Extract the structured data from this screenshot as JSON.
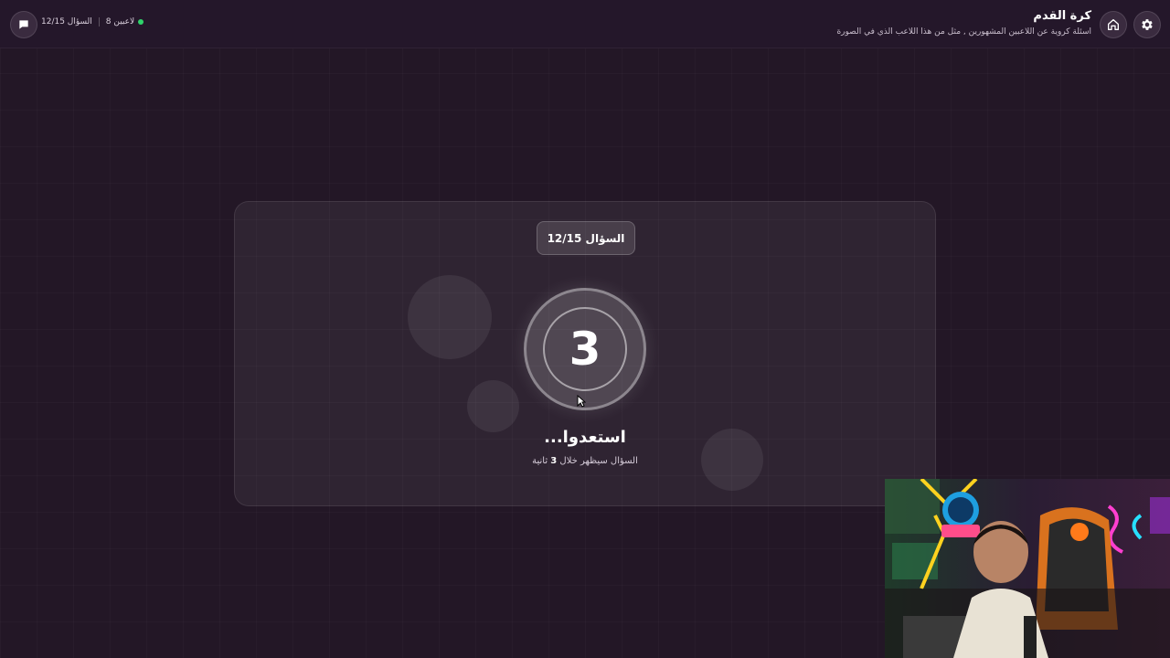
{
  "header": {
    "title": "كرة القدم",
    "subtitle": "اسئلة كروية عن اللاعبين المشهورين , مثل من هذا اللاعب الذي في الصورة",
    "status": {
      "players": "8 لاعبين",
      "question": "السؤال 12/15"
    },
    "icons": {
      "settings": "gear-icon",
      "home": "home-icon",
      "chat": "chat-icon"
    }
  },
  "card": {
    "question_badge": "السؤال 12/15",
    "countdown": "3",
    "ready_text": "استعدوا...",
    "sub_text_prefix": "السؤال سيظهر خلال ",
    "sub_text_number": "3",
    "sub_text_suffix": " ثانية"
  },
  "colors": {
    "background": "#231726",
    "online": "#2fd36b",
    "card": "#2f2333"
  }
}
